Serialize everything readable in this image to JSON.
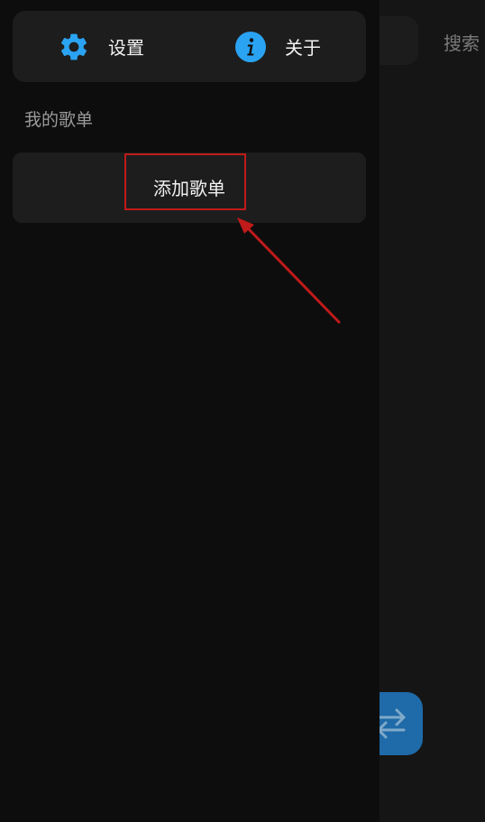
{
  "background": {
    "search_label": "搜索"
  },
  "drawer": {
    "top_actions": {
      "settings_label": "设置",
      "about_label": "关于"
    },
    "section_title": "我的歌单",
    "add_playlist_label": "添加歌单"
  },
  "colors": {
    "accent_blue": "#2aa3f2",
    "highlight_red": "#c01a1a",
    "drawer_bg": "#0d0d0d",
    "card_bg": "#1d1d1d",
    "fab_bg": "#1f6aa8"
  },
  "icons": {
    "settings": "gear-icon",
    "about": "info-icon",
    "fab": "swap-arrows-icon"
  }
}
